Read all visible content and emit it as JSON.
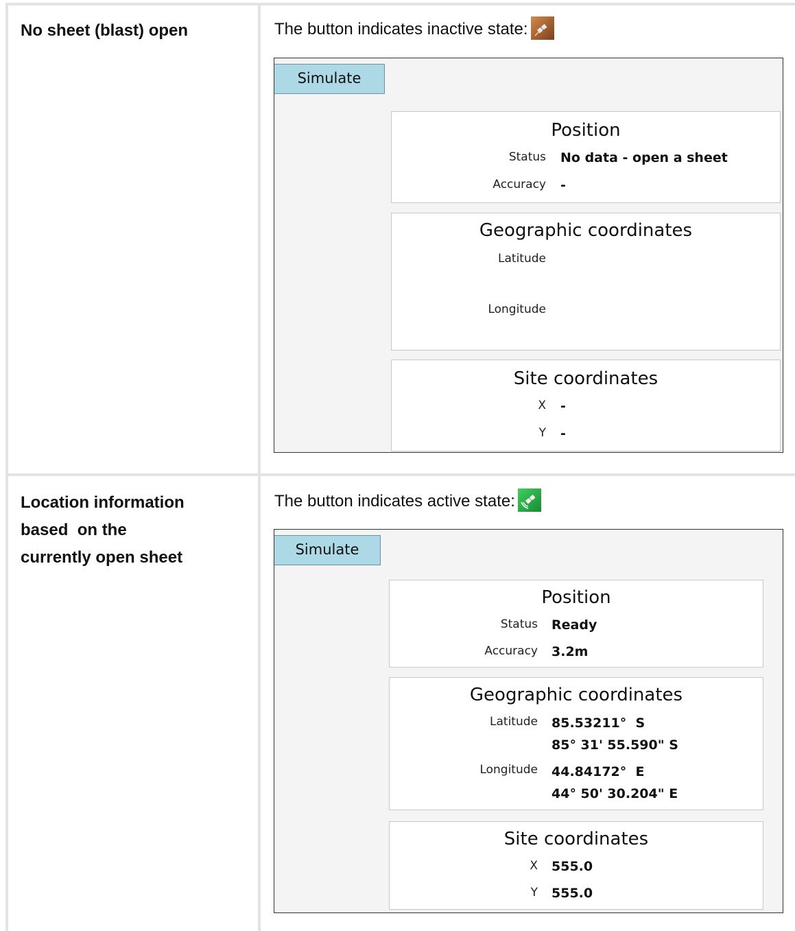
{
  "rows": [
    {
      "label": "No sheet (blast) open",
      "caption": "The button indicates inactive state:",
      "icon": "satellite-inactive-icon",
      "simulate_label": "Simulate",
      "position": {
        "title": "Position",
        "status_label": "Status",
        "status_value": "No data - open a sheet",
        "accuracy_label": "Accuracy",
        "accuracy_value": "-"
      },
      "geo": {
        "title": "Geographic coordinates",
        "latitude_label": "Latitude",
        "latitude_decimal": "",
        "latitude_dms": "",
        "longitude_label": "Longitude",
        "longitude_decimal": "",
        "longitude_dms": ""
      },
      "site": {
        "title": "Site coordinates",
        "x_label": "X",
        "x_value": "-",
        "y_label": "Y",
        "y_value": "-"
      }
    },
    {
      "label_lines": [
        "Location information",
        "based  on the",
        "currently open sheet"
      ],
      "caption": "The button indicates active state:",
      "icon": "satellite-active-icon",
      "simulate_label": "Simulate",
      "position": {
        "title": "Position",
        "status_label": "Status",
        "status_value": "Ready",
        "accuracy_label": "Accuracy",
        "accuracy_value": "3.2m"
      },
      "geo": {
        "title": "Geographic coordinates",
        "latitude_label": "Latitude",
        "latitude_decimal": "85.53211°  S",
        "latitude_dms": "85° 31' 55.590\" S",
        "longitude_label": "Longitude",
        "longitude_decimal": "44.84172°  E",
        "longitude_dms": "44° 50' 30.204\" E"
      },
      "site": {
        "title": "Site coordinates",
        "x_label": "X",
        "x_value": "555.0",
        "y_label": "Y",
        "y_value": "555.0"
      }
    }
  ],
  "colors": {
    "simulate_button": "#add8e6",
    "grid_line": "#e3e3e3",
    "panel_background": "#f4f4f4",
    "inactive_icon": "#9a5a2a",
    "active_icon": "#2bb34a"
  }
}
